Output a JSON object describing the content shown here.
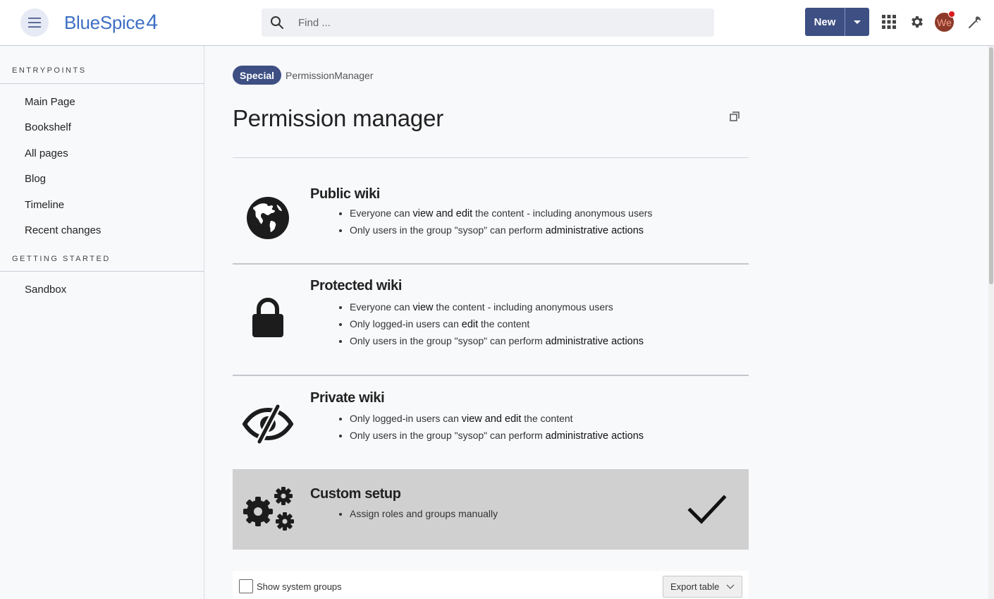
{
  "header": {
    "logo_text": "BlueSpice",
    "logo_version": "4",
    "search_placeholder": "Find ...",
    "new_label": "New",
    "avatar_initials": "We"
  },
  "sidebar": {
    "sections": [
      {
        "title": "ENTRYPOINTS",
        "items": [
          "Main Page",
          "Bookshelf",
          "All pages",
          "Blog",
          "Timeline",
          "Recent changes"
        ]
      },
      {
        "title": "GETTING STARTED",
        "items": [
          "Sandbox"
        ]
      }
    ]
  },
  "page": {
    "namespace_badge": "Special",
    "breadcrumb": "PermissionManager",
    "title": "Permission manager"
  },
  "options": [
    {
      "title": "Public wiki",
      "icon": "globe-icon",
      "selected": false,
      "bullets": [
        {
          "pre": "Everyone can ",
          "bold": "view and edit",
          "post": " the content - including anonymous users"
        },
        {
          "pre": "Only users in the group \"sysop\" can perform ",
          "bold": "administrative actions",
          "post": ""
        }
      ]
    },
    {
      "title": "Protected wiki",
      "icon": "lock-icon",
      "selected": false,
      "bullets": [
        {
          "pre": "Everyone can ",
          "bold": "view",
          "post": " the content - including anonymous users"
        },
        {
          "pre": "Only logged-in users can ",
          "bold": "edit",
          "post": " the content"
        },
        {
          "pre": "Only users in the group \"sysop\" can perform ",
          "bold": "administrative actions",
          "post": ""
        }
      ]
    },
    {
      "title": "Private wiki",
      "icon": "eye-slash-icon",
      "selected": false,
      "bullets": [
        {
          "pre": "Only logged-in users can ",
          "bold": "view and edit",
          "post": " the content"
        },
        {
          "pre": "Only users in the group \"sysop\" can perform ",
          "bold": "administrative actions",
          "post": ""
        }
      ]
    },
    {
      "title": "Custom setup",
      "icon": "gears-icon",
      "selected": true,
      "bullets": [
        {
          "pre": "Assign roles and groups manually",
          "bold": "",
          "post": ""
        }
      ]
    }
  ],
  "toolbar": {
    "show_system_groups_label": "Show system groups",
    "export_label": "Export table"
  },
  "colors": {
    "primary": "#3d4f83",
    "logo_blue": "#3e6fc5",
    "selected_bg": "#d0d0d0"
  }
}
